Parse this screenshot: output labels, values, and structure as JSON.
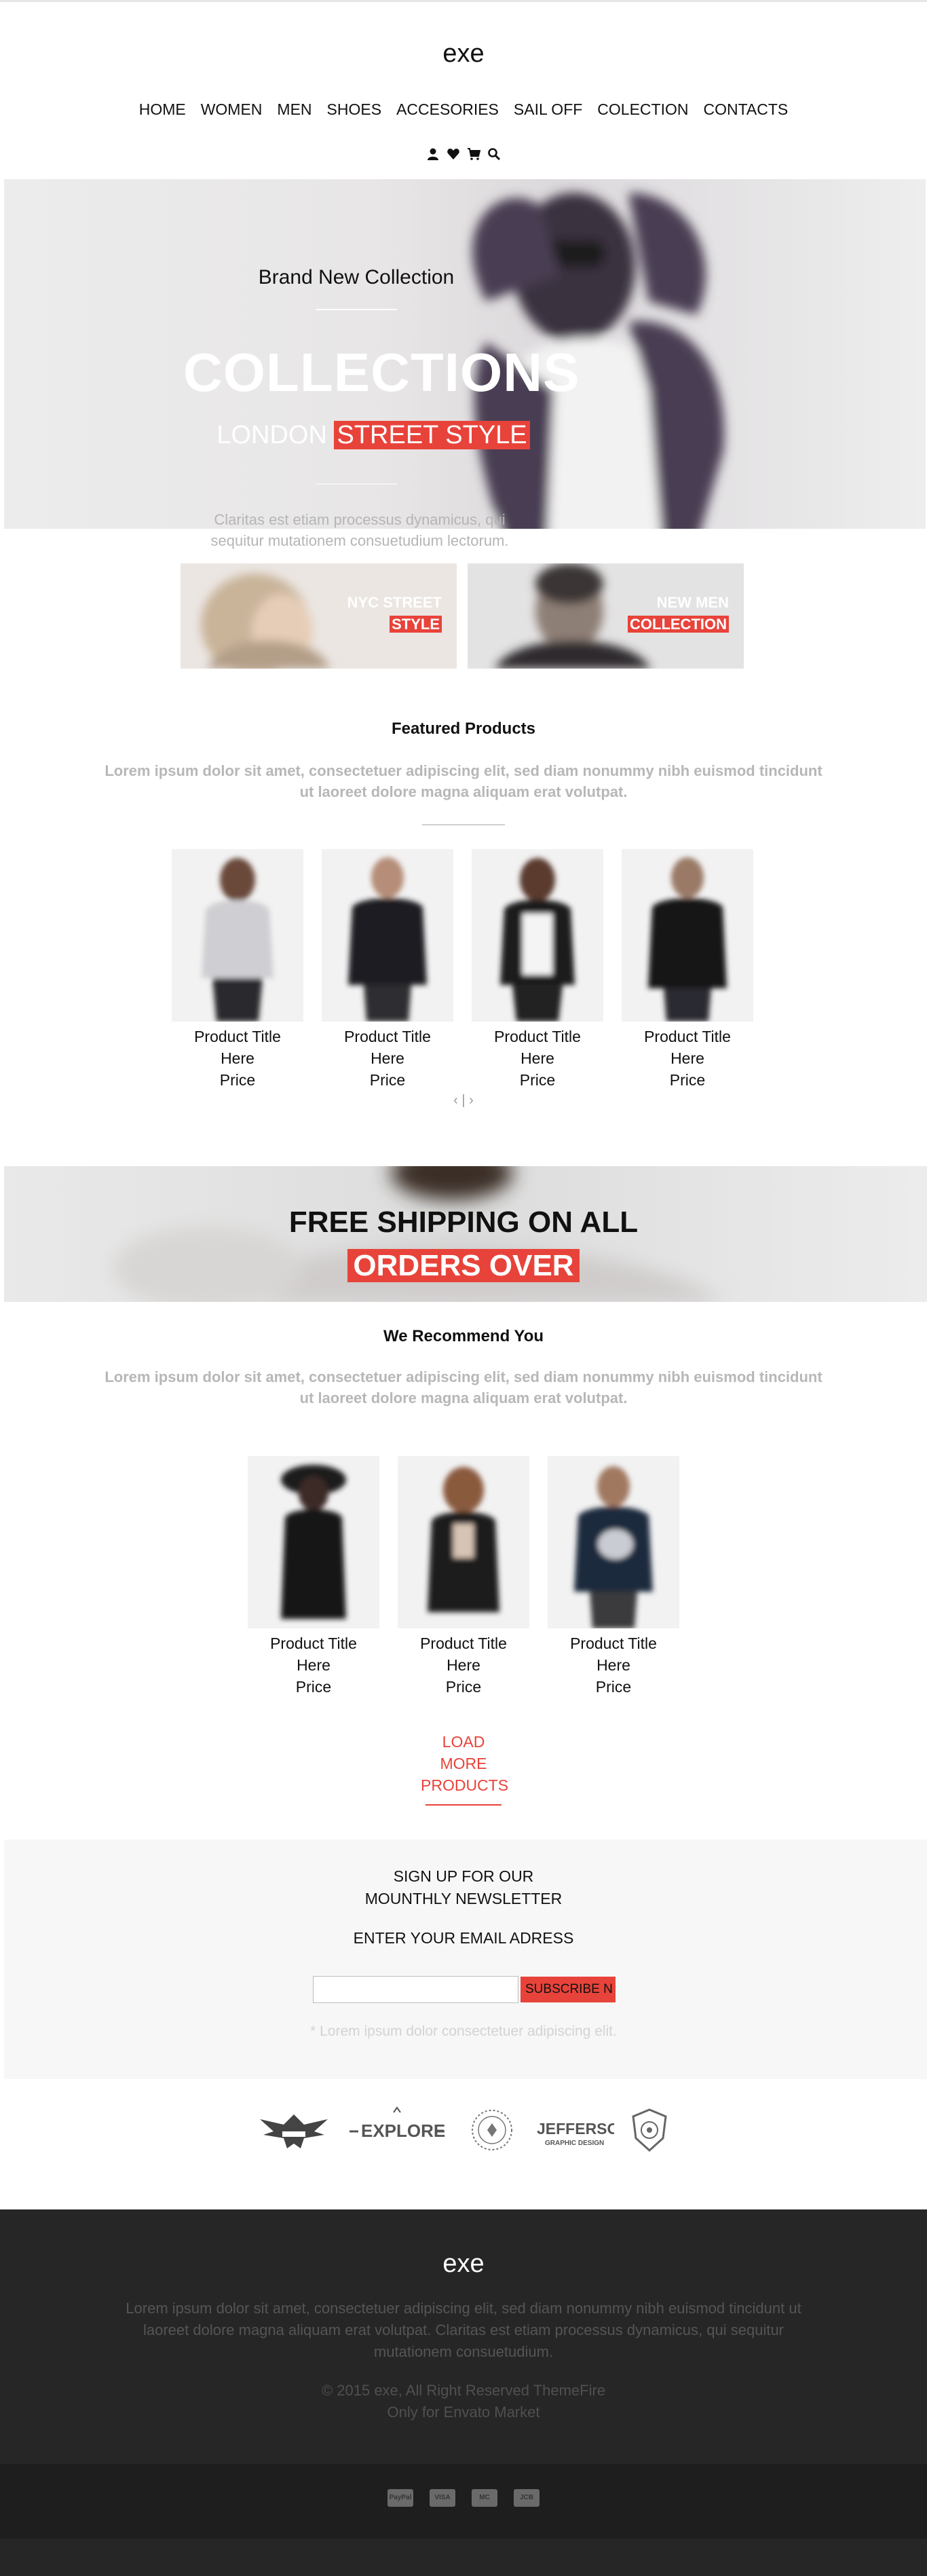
{
  "header": {
    "logo": "exe",
    "nav": [
      "HOME",
      "WOMEN",
      "MEN",
      "SHOES",
      "ACCESORIES",
      "SAIL OFF",
      "COLECTION",
      "CONTACTS"
    ],
    "icons": [
      "user-icon",
      "heart-icon",
      "cart-icon",
      "search-icon"
    ]
  },
  "hero": {
    "subtitle": "Brand New Collection",
    "title": "COLLECTIONS",
    "tag_plain": "LONDON",
    "tag_highlight": "STREET STYLE",
    "description": "Claritas est etiam processus dynamicus, qui sequitur mutationem consuetudium lectorum."
  },
  "promos": [
    {
      "line1": "NYC STREET",
      "line2": "STYLE"
    },
    {
      "line1": "NEW MEN",
      "line2": "COLLECTION"
    }
  ],
  "featured": {
    "title": "Featured Products",
    "description": "Lorem ipsum dolor sit amet, consectetuer adipiscing elit, sed diam nonummy nibh euismod tincidunt ut laoreet dolore magna aliquam erat volutpat.",
    "products": [
      {
        "title1": "Product Title",
        "title2": "Here",
        "price": "Price"
      },
      {
        "title1": "Product Title",
        "title2": "Here",
        "price": "Price"
      },
      {
        "title1": "Product Title",
        "title2": "Here",
        "price": "Price"
      },
      {
        "title1": "Product Title",
        "title2": "Here",
        "price": "Price"
      }
    ],
    "pager": "‹ | ›"
  },
  "shipping": {
    "line1": "FREE SHIPPING ON ALL",
    "line2": "ORDERS OVER"
  },
  "recommend": {
    "title": "We Recommend You",
    "description": "Lorem ipsum dolor sit amet, consectetuer adipiscing elit, sed diam nonummy nibh euismod tincidunt ut laoreet dolore magna aliquam erat volutpat.",
    "products": [
      {
        "title1": "Product Title",
        "title2": "Here",
        "price": "Price"
      },
      {
        "title1": "Product Title",
        "title2": "Here",
        "price": "Price"
      },
      {
        "title1": "Product Title",
        "title2": "Here",
        "price": "Price"
      }
    ],
    "load_more": [
      "LOAD",
      "MORE",
      "PRODUCTS"
    ]
  },
  "newsletter": {
    "title1": "SIGN UP FOR OUR",
    "title2": "MOUNTHLY NEWSLETTER",
    "label": "ENTER YOUR EMAIL ADRESS",
    "input_value": "",
    "button": "SUBSCRIBE N",
    "note": "* Lorem ipsum dolor consectetuer adipiscing elit."
  },
  "brands": [
    "EXPLORE",
    "JEFFERSON",
    "GRAPHIC DESIGN"
  ],
  "footer": {
    "logo": "exe",
    "description": "Lorem ipsum dolor sit amet, consectetuer adipiscing elit, sed diam nonummy nibh euismod tincidunt ut laoreet dolore magna aliquam erat volutpat. Claritas est etiam processus dynamicus, qui sequitur mutationem consuetudium.",
    "copyright1": "© 2015 exe, All Right Reserved ThemeFire",
    "copyright2": "Only for Envato Market",
    "payments": [
      "PayPal",
      "VISA",
      "MC",
      "JCB"
    ]
  },
  "colors": {
    "accent": "#e8433a",
    "footer_bg": "#262626",
    "muted_text": "#b7b7b7"
  }
}
